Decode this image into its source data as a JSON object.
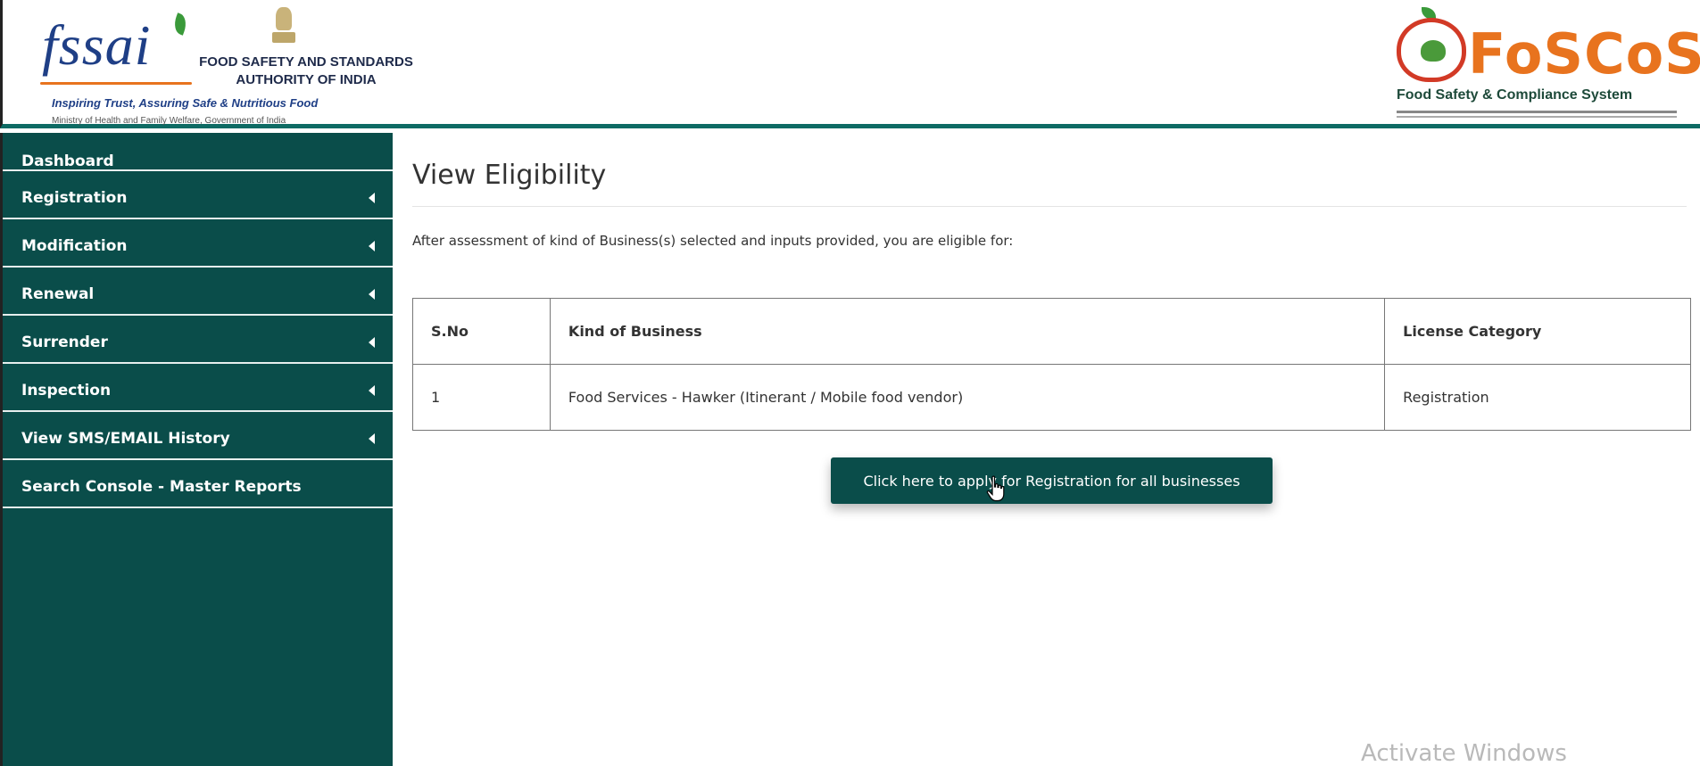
{
  "header": {
    "fssai": {
      "wordmark": "fssai",
      "authority_line1": "FOOD SAFETY AND STANDARDS",
      "authority_line2": "AUTHORITY OF INDIA",
      "tagline": "Inspiring Trust, Assuring Safe & Nutritious Food",
      "ministry": "Ministry of Health and Family Welfare, Government of India"
    },
    "foscos": {
      "wordmark": "FoSCoS",
      "subtitle": "Food Safety & Compliance System"
    }
  },
  "sidebar": {
    "items": [
      {
        "label": "Dashboard",
        "has_submenu": false
      },
      {
        "label": "Registration",
        "has_submenu": true
      },
      {
        "label": "Modification",
        "has_submenu": true
      },
      {
        "label": "Renewal",
        "has_submenu": true
      },
      {
        "label": "Surrender",
        "has_submenu": true
      },
      {
        "label": "Inspection",
        "has_submenu": true
      },
      {
        "label": "View SMS/EMAIL History",
        "has_submenu": true
      },
      {
        "label": "Search Console - Master Reports",
        "has_submenu": false
      }
    ]
  },
  "main": {
    "title": "View Eligibility",
    "intro": "After assessment of kind of Business(s) selected and inputs provided, you are eligible for:",
    "table": {
      "headers": [
        "S.No",
        "Kind of Business",
        "License Category"
      ],
      "rows": [
        [
          "1",
          "Food Services - Hawker (Itinerant / Mobile food vendor)",
          "Registration"
        ]
      ]
    },
    "apply_button": "Click here to apply for Registration for all businesses"
  },
  "watermark": "Activate Windows",
  "colors": {
    "sidebar_bg": "#0a4d4a",
    "accent_orange": "#e8731e",
    "brand_blue": "#1f3f86"
  }
}
